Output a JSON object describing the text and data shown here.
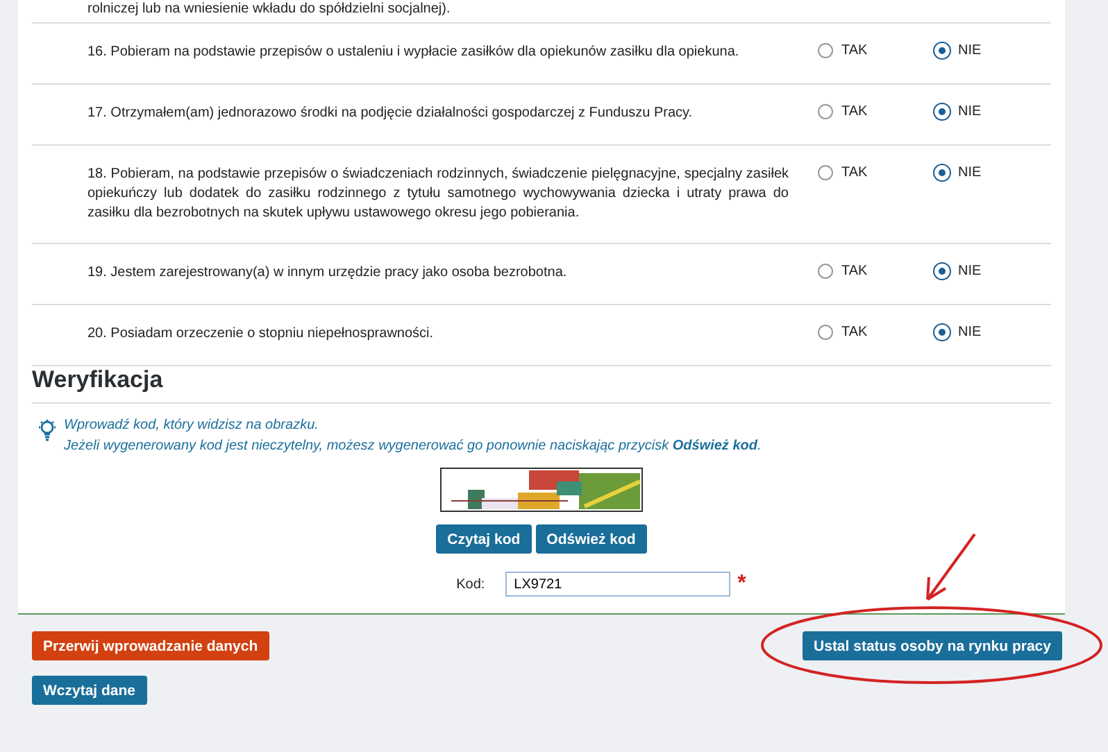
{
  "previous_text": "rolniczej lub na wniesienie wkładu do spółdzielni socjalnej).",
  "questions": [
    {
      "text": "16. Pobieram na podstawie przepisów o ustaleniu i wypłacie zasiłków dla opiekunów zasiłku dla opiekuna.",
      "options": [
        {
          "label": "TAK",
          "selected": false
        },
        {
          "label": "NIE",
          "selected": true
        }
      ]
    },
    {
      "text": "17.  Otrzymałem(am) jednorazowo środki na podjęcie działalności gospodarczej z Funduszu Pracy.",
      "options": [
        {
          "label": "TAK",
          "selected": false
        },
        {
          "label": "NIE",
          "selected": true
        }
      ]
    },
    {
      "text": "18. Pobieram, na podstawie przepisów o świadczeniach rodzinnych, świadczenie pielęgnacyjne, specjalny zasiłek opiekuńczy lub dodatek do zasiłku rodzinnego z tytułu samotnego wychowywania dziecka i utraty prawa do zasiłku dla bezrobotnych na skutek upływu ustawowego okresu jego pobierania.",
      "options": [
        {
          "label": "TAK",
          "selected": false
        },
        {
          "label": "NIE",
          "selected": true
        }
      ]
    },
    {
      "text": "19.  Jestem zarejestrowany(a) w innym urzędzie pracy jako osoba bezrobotna.",
      "options": [
        {
          "label": "TAK",
          "selected": false
        },
        {
          "label": "NIE",
          "selected": true
        }
      ]
    },
    {
      "text": "20. Posiadam orzeczenie o stopniu niepełnosprawności.",
      "options": [
        {
          "label": "TAK",
          "selected": false
        },
        {
          "label": "NIE",
          "selected": true
        }
      ]
    }
  ],
  "verification": {
    "heading": "Weryfikacja",
    "hint": [
      "Wprowadź kod, który widzisz na obrazku.",
      "Jeżeli wygenerowany kod jest nieczytelny, możesz wygenerować go ponownie naciskając przycisk **Odśwież kod**."
    ],
    "buttons": [
      "Czytaj kod",
      "Odśwież kod"
    ],
    "code_label": "Kod:",
    "code_value": "LX9721",
    "required_mark": "*"
  },
  "actions": {
    "cancel": "Przerwij wprowadzanie danych",
    "submit": "Ustal status osoby na rynku pracy",
    "load": "Wczytaj dane"
  }
}
